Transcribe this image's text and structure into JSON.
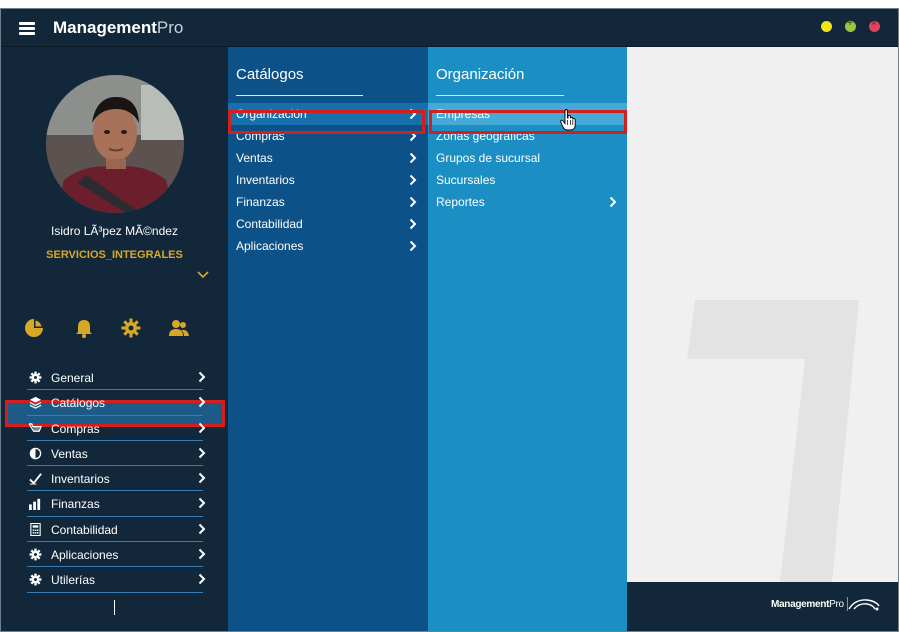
{
  "app": {
    "title_bold": "Management",
    "title_light": "Pro"
  },
  "window_controls": {
    "minimize_color": "#f2e418",
    "maximize_color": "#9bc53d",
    "close_color": "#e0435a"
  },
  "user": {
    "name": "Isidro LÃ³pez MÃ©ndez",
    "company": "SERVICIOS_INTEGRALES"
  },
  "quick_icons": [
    "pie-chart-icon",
    "bell-icon",
    "gear-icon",
    "users-icon"
  ],
  "sidebar_menu": [
    {
      "label": "General",
      "icon": "gear-icon"
    },
    {
      "label": "Catálogos",
      "icon": "layers-icon",
      "active": true
    },
    {
      "label": "Compras",
      "icon": "cart-icon"
    },
    {
      "label": "Ventas",
      "icon": "sales-icon"
    },
    {
      "label": "Inventarios",
      "icon": "check-icon"
    },
    {
      "label": "Finanzas",
      "icon": "bar-chart-icon"
    },
    {
      "label": "Contabilidad",
      "icon": "calculator-icon"
    },
    {
      "label": "Aplicaciones",
      "icon": "gear-icon"
    },
    {
      "label": "Utilerías",
      "icon": "gear-icon"
    }
  ],
  "catalogos_panel": {
    "title": "Catálogos",
    "items": [
      {
        "label": "Organización",
        "active": true
      },
      {
        "label": "Compras"
      },
      {
        "label": "Ventas"
      },
      {
        "label": "Inventarios"
      },
      {
        "label": "Finanzas"
      },
      {
        "label": "Contabilidad"
      },
      {
        "label": "Aplicaciones"
      }
    ]
  },
  "organizacion_panel": {
    "title": "Organización",
    "items": [
      {
        "label": "Empresas",
        "active": true,
        "submenu": false
      },
      {
        "label": "Zonas geográficas",
        "submenu": false
      },
      {
        "label": "Grupos de sucursal",
        "submenu": false
      },
      {
        "label": "Sucursales",
        "submenu": false
      },
      {
        "label": "Reportes",
        "submenu": true
      }
    ]
  },
  "footer": {
    "logo_bold": "Management",
    "logo_light": "Pro"
  },
  "colors": {
    "navy": "#12283a",
    "catalog_blue": "#0c5289",
    "org_blue": "#1b8fc4",
    "accent_gold": "#d8a726",
    "highlight_red": "#d41f1f"
  }
}
